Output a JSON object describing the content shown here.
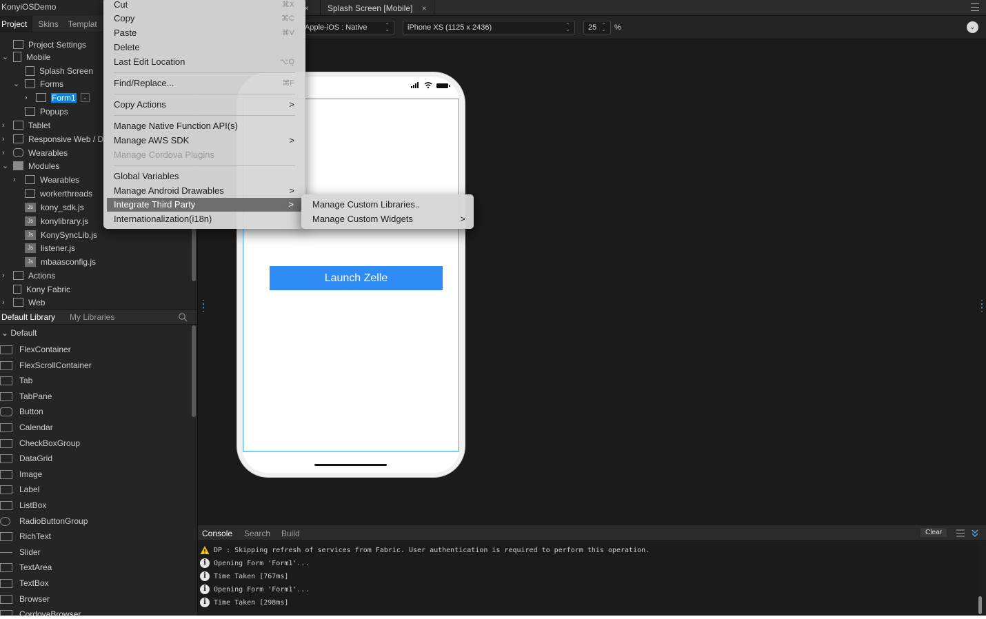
{
  "project": {
    "title": "KonyiOSDemo",
    "tabs": [
      "Project",
      "Skins",
      "Templat"
    ]
  },
  "tree": {
    "project_settings": "Project Settings",
    "mobile": "Mobile",
    "splash_screen": "Splash Screen",
    "forms": "Forms",
    "form1": "Form1",
    "popups": "Popups",
    "tablet": "Tablet",
    "responsive_web": "Responsive Web / D",
    "wearables": "Wearables",
    "modules": "Modules",
    "modules_wearables": "Wearables",
    "workerthreads": "workerthreads",
    "js_badge": "Js",
    "js_files": [
      "kony_sdk.js",
      "konylibrary.js",
      "KonySyncLib.js",
      "listener.js",
      "mbaasconfig.js"
    ],
    "actions": "Actions",
    "kony_fabric": "Kony Fabric",
    "web": "Web"
  },
  "library": {
    "tabs": [
      "Default Library",
      "My Libraries"
    ],
    "group": "Default",
    "widgets": [
      "FlexContainer",
      "FlexScrollContainer",
      "Tab",
      "TabPane",
      "Button",
      "Calendar",
      "CheckBoxGroup",
      "DataGrid",
      "Image",
      "Label",
      "ListBox",
      "RadioButtonGroup",
      "RichText",
      "Slider",
      "TextArea",
      "TextBox",
      "Browser",
      "CordovaBrowser"
    ]
  },
  "editor": {
    "tabs": [
      "Splash Screen [Mobile]"
    ],
    "close_glyph": "×",
    "platform": "Apple-iOS : Native",
    "device": "iPhone XS (1125 x 2436)",
    "zoom": "25",
    "zoom_unit": "%"
  },
  "phone": {
    "button_label": "Launch Zelle"
  },
  "console": {
    "tabs": [
      "Console",
      "Search",
      "Build"
    ],
    "clear_label": "Clear",
    "logs": [
      {
        "type": "warning",
        "text": "DP : Skipping refresh of services from Fabric. User authentication is required to perform this operation."
      },
      {
        "type": "info",
        "text": "Opening Form 'Form1'..."
      },
      {
        "type": "info",
        "text": "Time Taken [767ms]"
      },
      {
        "type": "info",
        "text": "Opening Form 'Form1'..."
      },
      {
        "type": "info",
        "text": "Time Taken [298ms]"
      }
    ]
  },
  "context_menu": {
    "items": [
      {
        "label": "Cut",
        "shortcut": "⌘X"
      },
      {
        "label": "Copy",
        "shortcut": "⌘C"
      },
      {
        "label": "Paste",
        "shortcut": "⌘V"
      },
      {
        "label": "Delete",
        "shortcut": ""
      },
      {
        "label": "Last Edit Location",
        "shortcut": "⌥Q"
      },
      {
        "label": "Find/Replace...",
        "shortcut": "⌘F"
      },
      {
        "label": "Copy Actions",
        "shortcut": "",
        "submenu": true
      },
      {
        "label": "Manage Native Function API(s)",
        "shortcut": ""
      },
      {
        "label": "Manage AWS SDK",
        "shortcut": "",
        "submenu": true
      },
      {
        "label": "Manage Cordova Plugins",
        "shortcut": "",
        "disabled": true
      },
      {
        "label": "Global Variables",
        "shortcut": ""
      },
      {
        "label": "Manage Android Drawables",
        "shortcut": "",
        "submenu": true
      },
      {
        "label": "Integrate Third Party",
        "shortcut": "",
        "submenu": true,
        "highlighted": true
      },
      {
        "label": "Internationalization(i18n)",
        "shortcut": ""
      }
    ],
    "submenu_arrow": ">"
  },
  "submenu": {
    "items": [
      {
        "label": "Manage Custom Libraries..",
        "submenu": false
      },
      {
        "label": "Manage Custom Widgets",
        "submenu": true
      }
    ]
  },
  "colors": {
    "accent": "#2f8cf5",
    "selection": "#0a84d8",
    "menu_highlight": "#6e6e6e",
    "warning": "#f5c400"
  }
}
